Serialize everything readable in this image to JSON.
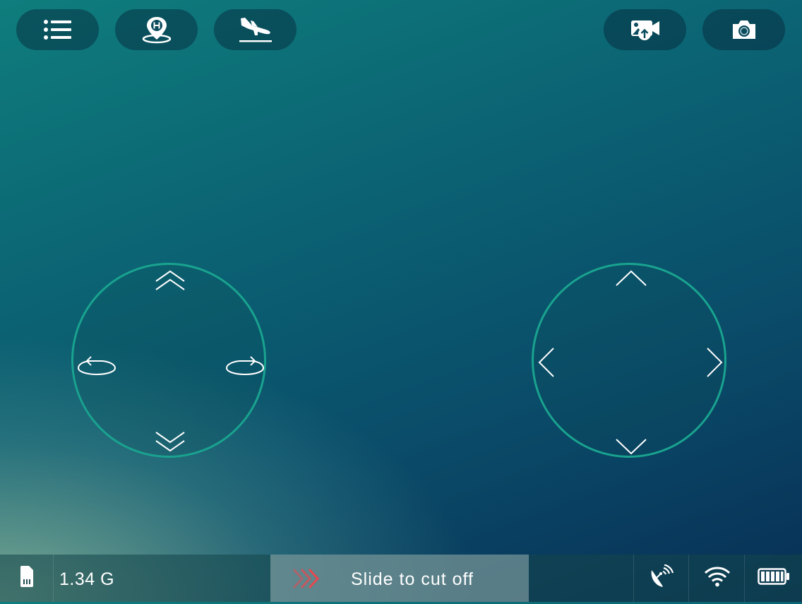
{
  "toolbar": {
    "menu_icon": "list-icon",
    "home_icon": "home-point-location-icon",
    "land_icon": "landing-plane-icon",
    "gallery_icon": "media-upload-icon",
    "camera_icon": "camera-icon"
  },
  "left_joystick": {
    "up_icon": "double-chevron-up-icon",
    "down_icon": "double-chevron-down-icon",
    "rotate_left_icon": "rotate-left-icon",
    "rotate_right_icon": "rotate-right-icon"
  },
  "right_joystick": {
    "up_icon": "chevron-up-icon",
    "down_icon": "chevron-down-icon",
    "left_icon": "chevron-left-icon",
    "right_icon": "chevron-right-icon"
  },
  "status": {
    "sd_icon": "sd-card-icon",
    "storage": "1.34 G",
    "slider_label": "Slide to cut off",
    "signal_icon": "satellite-dish-icon",
    "wifi_icon": "wifi-icon",
    "battery_icon": "battery-icon",
    "battery_level": 1.0
  },
  "colors": {
    "joystick_ring": "#19a38f",
    "slider_handle": "#e8474f"
  }
}
